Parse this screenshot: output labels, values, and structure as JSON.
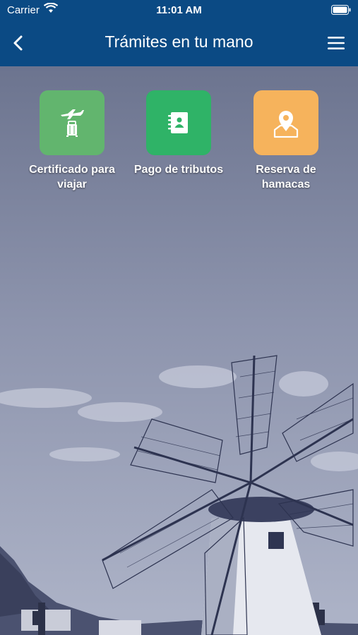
{
  "status_bar": {
    "carrier": "Carrier",
    "time": "11:01 AM"
  },
  "header": {
    "title": "Trámites en tu mano"
  },
  "tiles": [
    {
      "label": "Certificado para viajar",
      "color": "#62b56e",
      "icon": "travel-certificate-icon"
    },
    {
      "label": "Pago de tributos",
      "color": "#2fb367",
      "icon": "contact-book-icon"
    },
    {
      "label": "Reserva de hamacas",
      "color": "#f6b35c",
      "icon": "map-pin-icon"
    }
  ],
  "colors": {
    "header": "#0b4a84",
    "sky_top": "#6f7791",
    "sky_bottom": "#a9b0c4"
  }
}
